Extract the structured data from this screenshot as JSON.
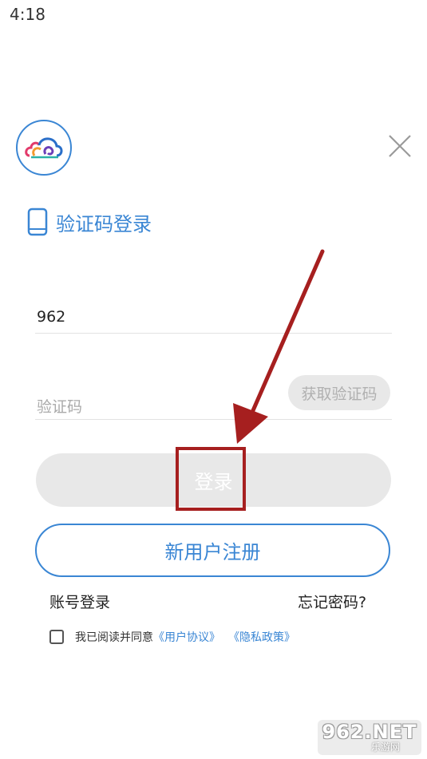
{
  "status_bar": {
    "time": "4:18"
  },
  "header": {
    "logo_icon": "cloud-swirl-logo-icon",
    "close_icon": "close-icon"
  },
  "login_mode": {
    "icon": "phone-icon",
    "title": "验证码登录"
  },
  "phone_field": {
    "value": "962"
  },
  "code_field": {
    "placeholder": "验证码",
    "get_code_label": "获取验证码"
  },
  "login_button": {
    "label": "登录"
  },
  "register_button": {
    "label": "新用户注册"
  },
  "links": {
    "account_login": "账号登录",
    "forgot_password": "忘记密码?"
  },
  "agreement": {
    "checked": false,
    "text": "我已阅读并同意",
    "user_agreement": "《用户协议》",
    "privacy_policy": "《隐私政策》"
  },
  "watermark": {
    "main": "962.NET",
    "sub": "乐游网"
  },
  "colors": {
    "accent": "#3a86d4",
    "annotation": "#a61f1f",
    "disabled_bg": "#e8e8e8"
  }
}
